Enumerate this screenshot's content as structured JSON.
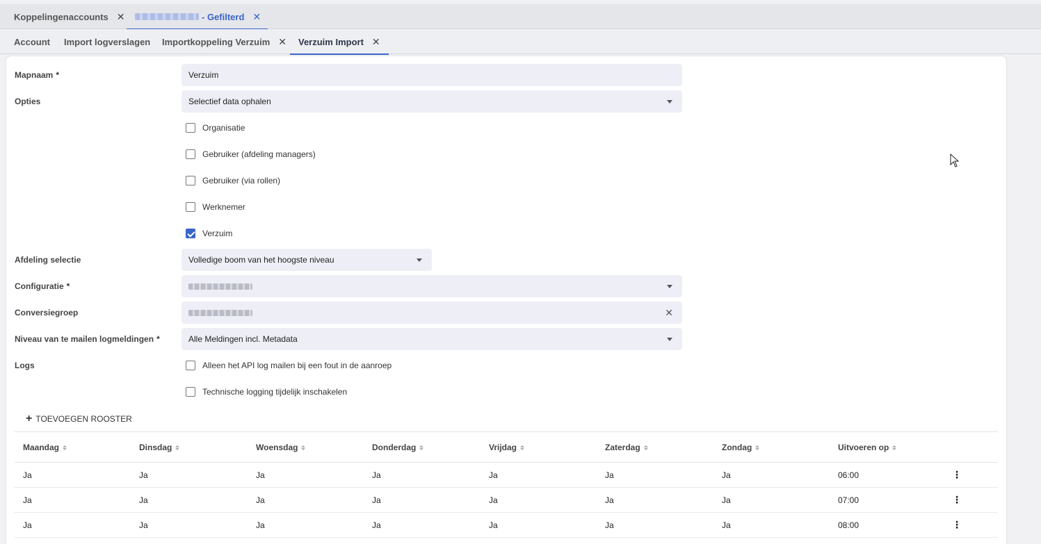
{
  "top_tabs": [
    {
      "label": "Koppelingenaccounts",
      "close": "✕"
    },
    {
      "label": "- Gefilterd",
      "close": "✕"
    }
  ],
  "sub_tabs": [
    {
      "label": "Account"
    },
    {
      "label": "Import logverslagen"
    },
    {
      "label": "Importkoppeling Verzuim",
      "close": "✕"
    },
    {
      "label": "Verzuim Import",
      "close": "✕"
    }
  ],
  "form": {
    "mapnaam": {
      "label": "Mapnaam",
      "required": "*",
      "value": "Verzuim"
    },
    "opties": {
      "label": "Opties",
      "value": "Selectief data ophalen",
      "checkboxes": [
        {
          "label": "Organisatie",
          "checked": false
        },
        {
          "label": "Gebruiker (afdeling managers)",
          "checked": false
        },
        {
          "label": "Gebruiker (via rollen)",
          "checked": false
        },
        {
          "label": "Werknemer",
          "checked": false
        },
        {
          "label": "Verzuim",
          "checked": true
        }
      ]
    },
    "afdeling": {
      "label": "Afdeling selectie",
      "value": "Volledige boom van het hoogste niveau"
    },
    "configuratie": {
      "label": "Configuratie",
      "required": "*"
    },
    "conversiegroep": {
      "label": "Conversiegroep",
      "clear": "✕"
    },
    "niveau": {
      "label": "Niveau van te mailen logmeldingen",
      "required": "*",
      "value": "Alle Meldingen incl. Metadata"
    },
    "logs": {
      "label": "Logs",
      "checkboxes": [
        {
          "label": "Alleen het API log mailen bij een fout in de aanroep",
          "checked": false
        },
        {
          "label": "Technische logging tijdelijk inschakelen",
          "checked": false
        }
      ]
    }
  },
  "add_button": {
    "icon": "+",
    "label": "TOEVOEGEN ROOSTER"
  },
  "table": {
    "headers": [
      "Maandag",
      "Dinsdag",
      "Woensdag",
      "Donderdag",
      "Vrijdag",
      "Zaterdag",
      "Zondag",
      "Uitvoeren op"
    ],
    "rows": [
      [
        "Ja",
        "Ja",
        "Ja",
        "Ja",
        "Ja",
        "Ja",
        "Ja",
        "06:00"
      ],
      [
        "Ja",
        "Ja",
        "Ja",
        "Ja",
        "Ja",
        "Ja",
        "Ja",
        "07:00"
      ],
      [
        "Ja",
        "Ja",
        "Ja",
        "Ja",
        "Ja",
        "Ja",
        "Ja",
        "08:00"
      ]
    ],
    "row_menu_icon": "⋮"
  },
  "colors": {
    "accent": "#3a64c8",
    "field_bg": "#eeeff6"
  }
}
